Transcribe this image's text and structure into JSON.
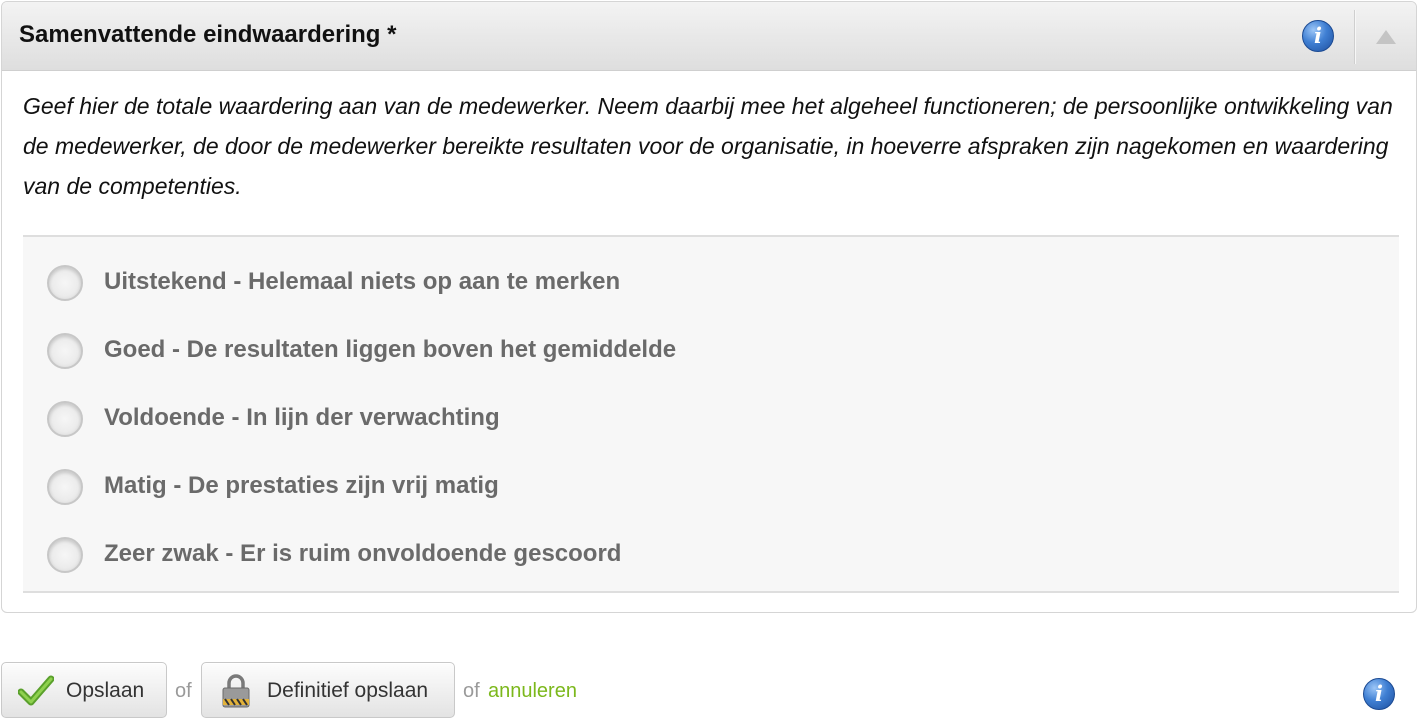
{
  "panel": {
    "title": "Samenvattende eindwaardering *",
    "description": "Geef hier de totale waardering aan van de medewerker. Neem daarbij mee het algeheel functioneren; de persoonlijke ontwikkeling van de medewerker, de door de medewerker bereikte resultaten voor de organisatie, in hoeverre afspraken zijn nagekomen en waardering van de competenties.",
    "info_icon": "info-icon",
    "collapse_icon": "triangle-up-icon",
    "options": [
      {
        "label": "Uitstekend - Helemaal niets op aan te merken",
        "selected": false
      },
      {
        "label": "Goed - De resultaten liggen boven het gemiddelde",
        "selected": false
      },
      {
        "label": "Voldoende - In lijn der verwachting",
        "selected": false
      },
      {
        "label": "Matig - De prestaties zijn vrij matig",
        "selected": false
      },
      {
        "label": "Zeer zwak - Er is ruim onvoldoende gescoord",
        "selected": false
      }
    ]
  },
  "footer": {
    "save_label": "Opslaan",
    "separator_1": "of",
    "final_save_label": "Definitief opslaan",
    "separator_2": "of",
    "cancel_label": "annuleren",
    "save_icon": "checkmark-icon",
    "final_save_icon": "padlock-icon"
  },
  "colors": {
    "cancel_link": "#7cb81c",
    "info_blue": "#3f7fd3",
    "option_text": "#6a6a6a",
    "checkmark_green": "#5aa02c"
  }
}
